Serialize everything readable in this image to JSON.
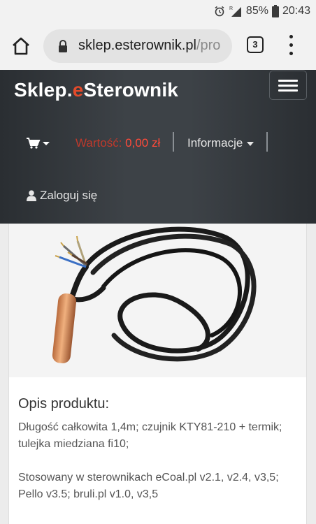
{
  "status_bar": {
    "battery": "85%",
    "time": "20:43"
  },
  "browser": {
    "url_domain": "sklep.esterownik.pl",
    "url_path": "/pro",
    "tab_count": "3"
  },
  "site": {
    "logo_part1": "Sklep.",
    "logo_accent": "e",
    "logo_part2": "Sterownik",
    "cart_value_label": "Wartość:",
    "cart_value": "0,00 zł",
    "info_label": "Informacje",
    "login_label": "Zaloguj się"
  },
  "product": {
    "section_title": "Opis produktu:",
    "description_1": "Długość całkowita 1,4m; czujnik KTY81-210 + termik; tulejka miedziana fi10;",
    "description_2": "Stosowany w sterownikach eCoal.pl v2.1, v2.4, v3,5; Pello v3.5; bruli.pl v1.0, v3,5"
  },
  "icons": {
    "home": "home-icon",
    "lock": "lock-icon",
    "menu": "more-vert-icon",
    "cart": "shopping-cart-icon",
    "user": "user-icon",
    "hamburger": "hamburger-icon"
  },
  "colors": {
    "brand_accent": "#e34a2a",
    "header_bg": "#3d4247",
    "cart_value": "#ff4a3a"
  }
}
